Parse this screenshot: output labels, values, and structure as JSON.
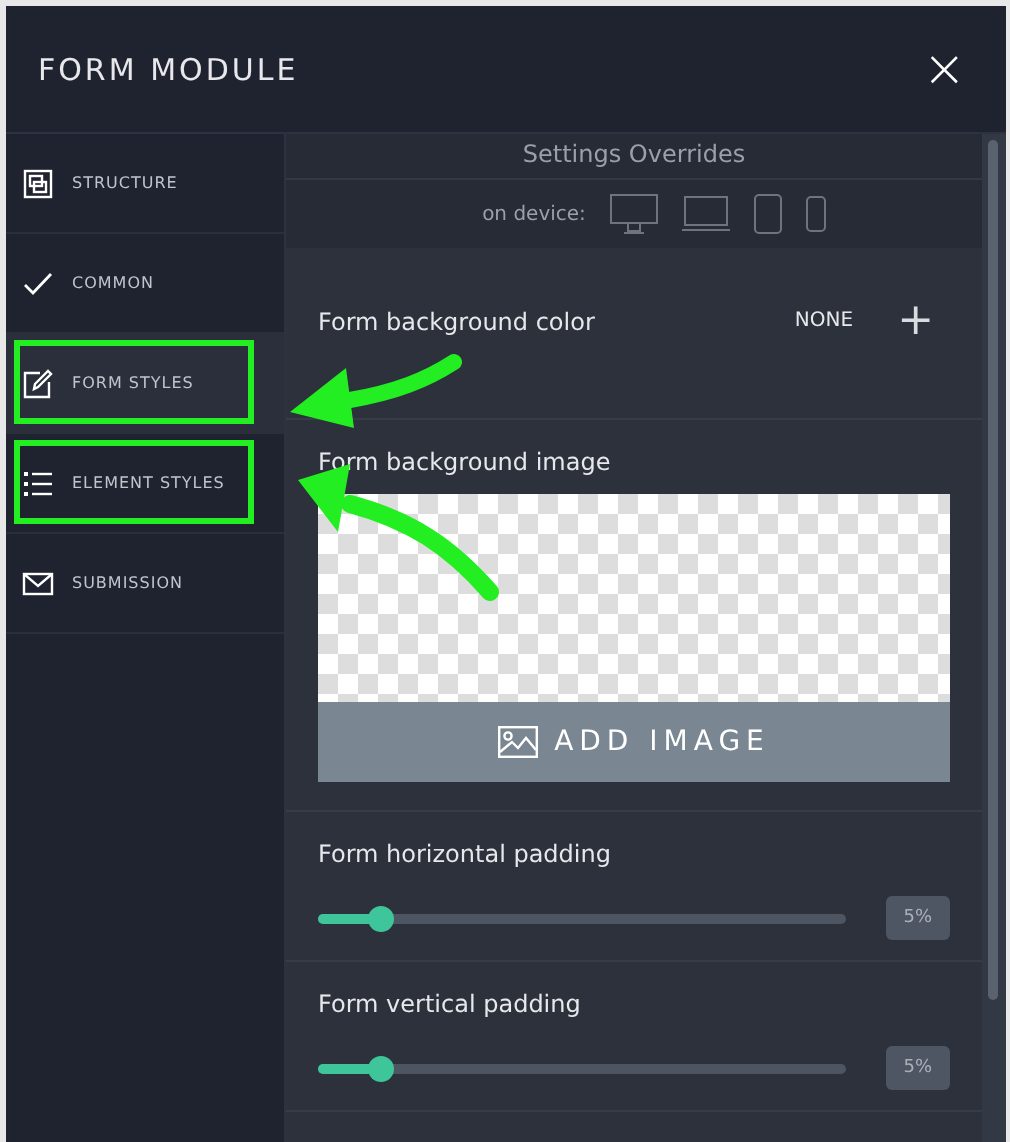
{
  "window": {
    "title": "FORM MODULE",
    "close": "×"
  },
  "sidebar": {
    "items": [
      {
        "label": "STRUCTURE",
        "selected": false,
        "highlighted": false
      },
      {
        "label": "COMMON",
        "selected": false,
        "highlighted": false
      },
      {
        "label": "FORM STYLES",
        "selected": true,
        "highlighted": true
      },
      {
        "label": "ELEMENT STYLES",
        "selected": false,
        "highlighted": true
      },
      {
        "label": "SUBMISSION",
        "selected": false,
        "highlighted": false
      }
    ]
  },
  "overrides": {
    "title": "Settings Overrides",
    "device_label": "on device:"
  },
  "background_color": {
    "label": "Form background color",
    "value": "NONE",
    "add": "+"
  },
  "background_image": {
    "label": "Form background image",
    "button": "ADD IMAGE"
  },
  "sliders": [
    {
      "label": "Form horizontal padding",
      "level": 0.12,
      "reading": "5%"
    },
    {
      "label": "Form vertical padding",
      "level": 0.12,
      "reading": "5%"
    }
  ]
}
